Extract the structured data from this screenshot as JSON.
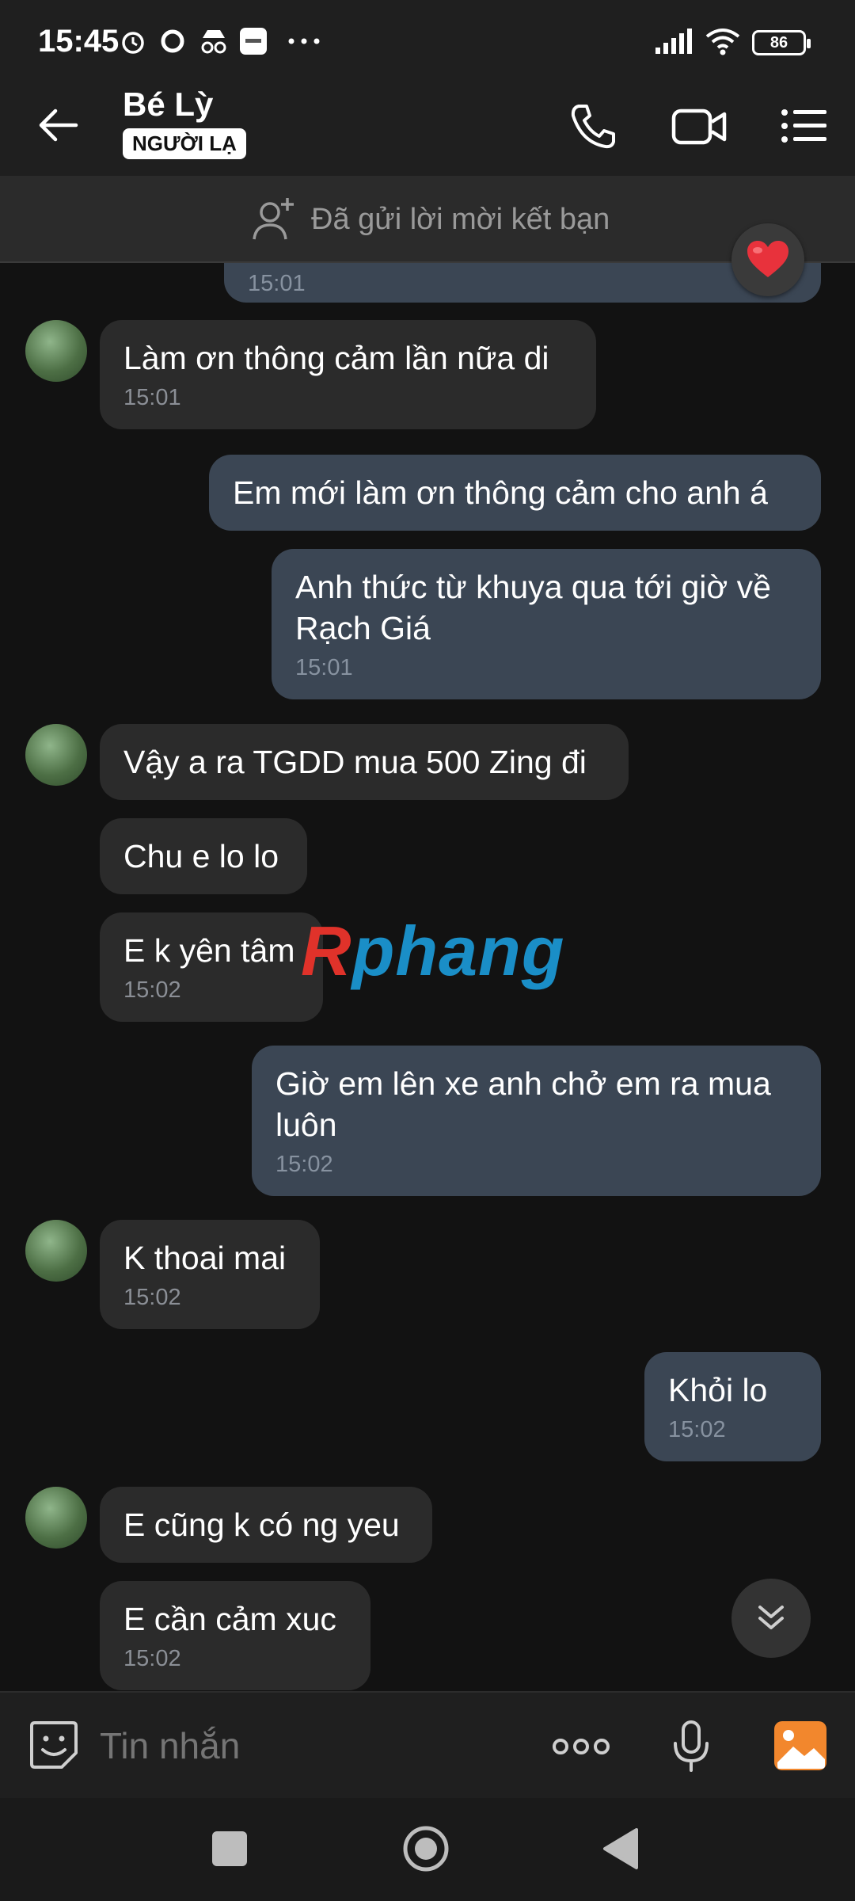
{
  "status_bar": {
    "time": "15:45",
    "battery": "86"
  },
  "header": {
    "name": "Bé Lỳ",
    "badge": "NGƯỜI LẠ"
  },
  "friend_banner": {
    "text": "Đã gửi lời mời kết bạn"
  },
  "messages": [
    {
      "dir": "out",
      "text": "",
      "time": "15:01"
    },
    {
      "dir": "in",
      "text": "Làm ơn thông cảm lần nữa di",
      "time": "15:01"
    },
    {
      "dir": "out",
      "text": "Em mới làm ơn thông cảm cho anh á",
      "time": ""
    },
    {
      "dir": "out",
      "text": "Anh thức từ khuya qua tới giờ về Rạch Giá",
      "time": "15:01"
    },
    {
      "dir": "in",
      "text": "Vậy a ra TGDD mua 500 Zing đi",
      "time": ""
    },
    {
      "dir": "in",
      "text": "Chu e lo lo",
      "time": ""
    },
    {
      "dir": "in",
      "text": "E k yên tâm",
      "time": "15:02"
    },
    {
      "dir": "out",
      "text": "Giờ em lên xe anh chở em ra mua luôn",
      "time": "15:02"
    },
    {
      "dir": "in",
      "text": "K thoai mai",
      "time": "15:02"
    },
    {
      "dir": "out",
      "text": "Khỏi lo",
      "time": "15:02"
    },
    {
      "dir": "in",
      "text": "E cũng k có ng yeu",
      "time": ""
    },
    {
      "dir": "in",
      "text": "E cần cảm xuc",
      "time": "15:02"
    }
  ],
  "watermark": {
    "first": "R",
    "rest": "phang"
  },
  "input": {
    "placeholder": "Tin nhắn"
  },
  "icons": {
    "back": "arrow-left-icon",
    "call": "phone-icon",
    "video": "video-camera-icon",
    "menu": "list-menu-icon",
    "add_friend": "add-user-icon",
    "heart": "heart-icon",
    "scroll": "double-chevron-down-icon",
    "sticker": "sticker-smile-icon",
    "more": "more-dots-icon",
    "mic": "microphone-icon",
    "image": "image-gallery-icon"
  },
  "colors": {
    "heart": "#e8323c",
    "image_icon": "#f2872d",
    "outgoing_bubble": "#3b4654",
    "incoming_bubble": "#2b2b2b"
  }
}
